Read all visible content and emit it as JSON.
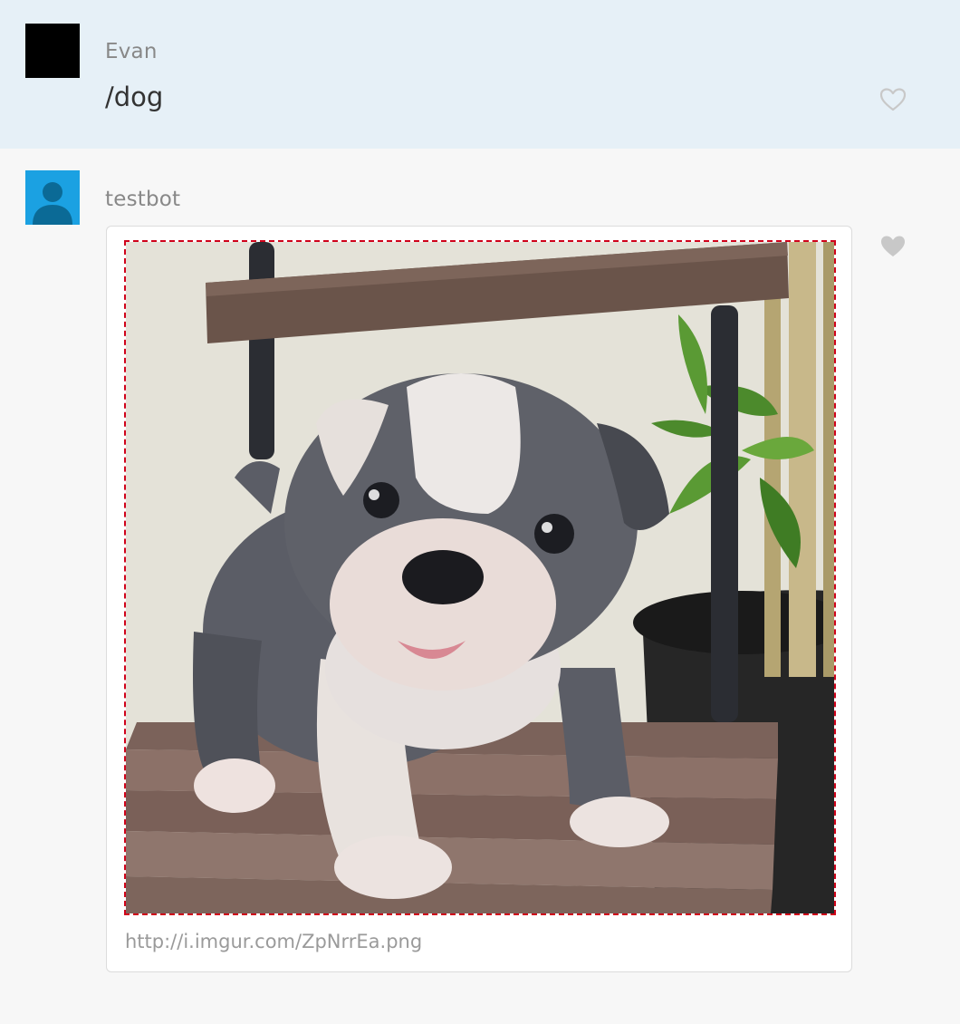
{
  "messages": [
    {
      "username": "Evan",
      "text": "/dog",
      "avatar": "black-square-avatar",
      "liked": false
    },
    {
      "username": "testbot",
      "avatar": "default-user-silhouette-avatar",
      "liked": true,
      "attachment": {
        "type": "image",
        "description_icon": "bulldog-puppy-photo",
        "url": "http://i.imgur.com/ZpNrrEa.png"
      }
    }
  ],
  "colors": {
    "user_message_bg": "#e6f0f7",
    "bot_message_bg": "#f7f7f7",
    "avatar_blue": "#1ba1e2",
    "heart_gray": "#c8c8c8",
    "image_border_dashed": "#d0021b"
  }
}
